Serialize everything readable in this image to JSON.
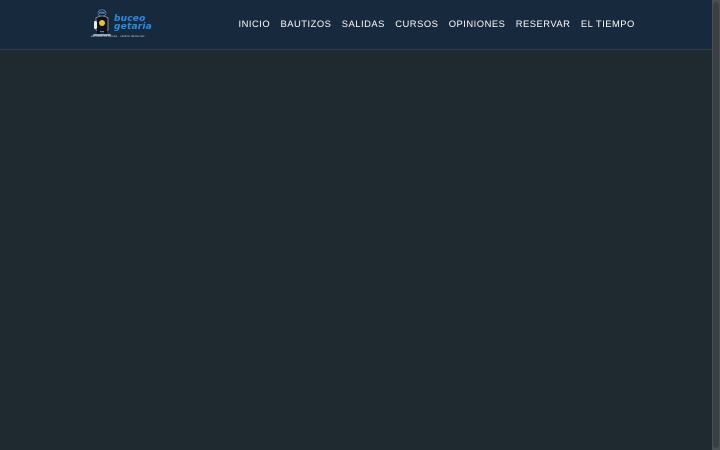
{
  "header": {
    "logo": {
      "line1": "buceo",
      "line2": "getaria",
      "tagline": "escuela de buceo · centro de buceo"
    },
    "nav": [
      {
        "label": "INICIO"
      },
      {
        "label": "BAUTIZOS"
      },
      {
        "label": "SALIDAS"
      },
      {
        "label": "CURSOS"
      },
      {
        "label": "OPINIONES"
      },
      {
        "label": "RESERVAR"
      },
      {
        "label": "EL TIEMPO"
      }
    ]
  },
  "colors": {
    "header_bg": "#17293c",
    "page_bg": "#1f2a30",
    "logo_blue": "#1e8fe6",
    "nav_text": "#ffffff"
  }
}
